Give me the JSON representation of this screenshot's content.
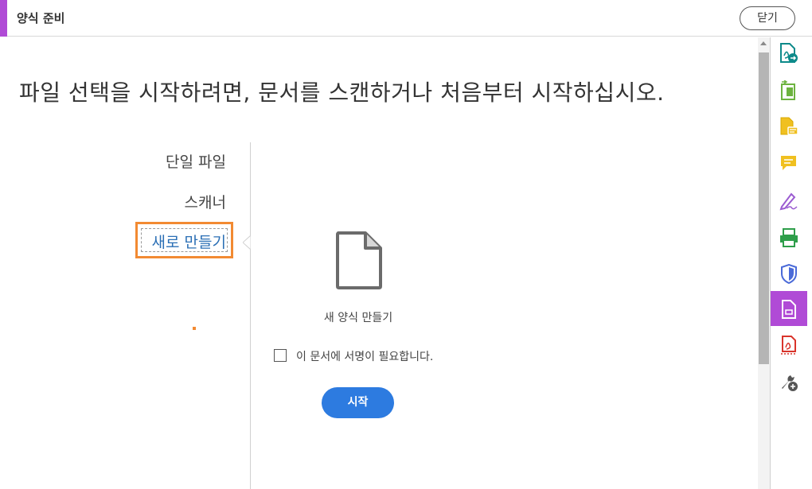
{
  "header": {
    "title": "양식 준비",
    "close_label": "닫기"
  },
  "main": {
    "headline": "파일 선택을 시작하려면, 문서를 스캔하거나 처음부터 시작하십시오.",
    "options": [
      {
        "label": "단일 파일"
      },
      {
        "label": "스캐너"
      },
      {
        "label": "새로 만들기",
        "selected": true
      }
    ],
    "form_label": "새 양식 만들기",
    "signature_checkbox": {
      "label": "이 문서에 서명이 필요합니다.",
      "checked": false
    },
    "start_label": "시작"
  },
  "right_tools": [
    {
      "icon": "export-pdf-icon"
    },
    {
      "icon": "organize-pages-icon"
    },
    {
      "icon": "comment-document-icon"
    },
    {
      "icon": "comment-icon"
    },
    {
      "icon": "fill-sign-icon"
    },
    {
      "icon": "print-production-icon"
    },
    {
      "icon": "protect-icon"
    },
    {
      "icon": "prepare-form-icon",
      "active": true
    },
    {
      "icon": "pdf-standards-icon"
    },
    {
      "icon": "more-tools-icon"
    }
  ],
  "colors": {
    "accent": "#b04bd6",
    "focus": "#f28a32",
    "primary": "#2d7be0"
  }
}
